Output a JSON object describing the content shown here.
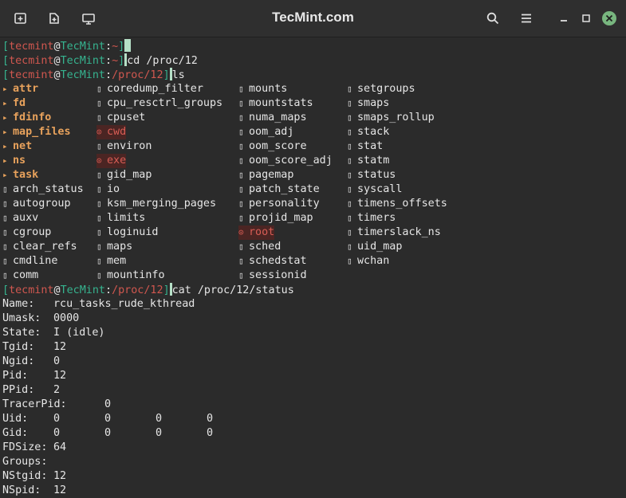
{
  "window": {
    "title": "TecMint.com",
    "buttons": [
      "new-tab",
      "new-window",
      "split"
    ]
  },
  "prompts": [
    {
      "user": "tecmint",
      "host": "TecMint",
      "path": "~",
      "cmd": ""
    },
    {
      "user": "tecmint",
      "host": "TecMint",
      "path": "~",
      "cmd": "cd /proc/12"
    },
    {
      "user": "tecmint",
      "host": "TecMint",
      "path": "/proc/12",
      "cmd": "ls"
    },
    {
      "user": "tecmint",
      "host": "TecMint",
      "path": "/proc/12",
      "cmd": "cat /proc/12/status"
    }
  ],
  "ls_rows": [
    [
      {
        "t": "attr",
        "k": "dir"
      },
      {
        "t": "coredump_filter",
        "k": "file"
      },
      {
        "t": "mounts",
        "k": "file"
      },
      {
        "t": "setgroups",
        "k": "file"
      }
    ],
    [
      {
        "t": "fd",
        "k": "dir"
      },
      {
        "t": "cpu_resctrl_groups",
        "k": "file"
      },
      {
        "t": "mountstats",
        "k": "file"
      },
      {
        "t": "smaps",
        "k": "file"
      }
    ],
    [
      {
        "t": "fdinfo",
        "k": "dir"
      },
      {
        "t": "cpuset",
        "k": "file"
      },
      {
        "t": "numa_maps",
        "k": "file"
      },
      {
        "t": "smaps_rollup",
        "k": "file"
      }
    ],
    [
      {
        "t": "map_files",
        "k": "dir"
      },
      {
        "t": "cwd",
        "k": "link"
      },
      {
        "t": "oom_adj",
        "k": "file"
      },
      {
        "t": "stack",
        "k": "file"
      }
    ],
    [
      {
        "t": "net",
        "k": "dir"
      },
      {
        "t": "environ",
        "k": "file"
      },
      {
        "t": "oom_score",
        "k": "file"
      },
      {
        "t": "stat",
        "k": "file"
      }
    ],
    [
      {
        "t": "ns",
        "k": "dir"
      },
      {
        "t": "exe",
        "k": "link"
      },
      {
        "t": "oom_score_adj",
        "k": "file"
      },
      {
        "t": "statm",
        "k": "file"
      }
    ],
    [
      {
        "t": "task",
        "k": "dir"
      },
      {
        "t": "gid_map",
        "k": "file"
      },
      {
        "t": "pagemap",
        "k": "file"
      },
      {
        "t": "status",
        "k": "file"
      }
    ],
    [
      {
        "t": "arch_status",
        "k": "file"
      },
      {
        "t": "io",
        "k": "file"
      },
      {
        "t": "patch_state",
        "k": "file"
      },
      {
        "t": "syscall",
        "k": "file"
      }
    ],
    [
      {
        "t": "autogroup",
        "k": "file"
      },
      {
        "t": "ksm_merging_pages",
        "k": "file"
      },
      {
        "t": "personality",
        "k": "file"
      },
      {
        "t": "timens_offsets",
        "k": "file"
      }
    ],
    [
      {
        "t": "auxv",
        "k": "file"
      },
      {
        "t": "limits",
        "k": "file"
      },
      {
        "t": "projid_map",
        "k": "file"
      },
      {
        "t": "timers",
        "k": "file"
      }
    ],
    [
      {
        "t": "cgroup",
        "k": "file"
      },
      {
        "t": "loginuid",
        "k": "file"
      },
      {
        "t": "root",
        "k": "link"
      },
      {
        "t": "timerslack_ns",
        "k": "file"
      }
    ],
    [
      {
        "t": "clear_refs",
        "k": "file"
      },
      {
        "t": "maps",
        "k": "file"
      },
      {
        "t": "sched",
        "k": "file"
      },
      {
        "t": "uid_map",
        "k": "file"
      }
    ],
    [
      {
        "t": "cmdline",
        "k": "file"
      },
      {
        "t": "mem",
        "k": "file"
      },
      {
        "t": "schedstat",
        "k": "file"
      },
      {
        "t": "wchan",
        "k": "file"
      }
    ],
    [
      {
        "t": "comm",
        "k": "file"
      },
      {
        "t": "mountinfo",
        "k": "file"
      },
      {
        "t": "sessionid",
        "k": "file"
      },
      null
    ]
  ],
  "status_lines": [
    {
      "key": "Name:",
      "vals": [
        "rcu_tasks_rude_kthread"
      ]
    },
    {
      "key": "Umask:",
      "vals": [
        "0000"
      ]
    },
    {
      "key": "State:",
      "vals": [
        "I (idle)"
      ]
    },
    {
      "key": "Tgid:",
      "vals": [
        "12"
      ]
    },
    {
      "key": "Ngid:",
      "vals": [
        "0"
      ]
    },
    {
      "key": "Pid:",
      "vals": [
        "12"
      ]
    },
    {
      "key": "PPid:",
      "vals": [
        "2"
      ]
    },
    {
      "key": "TracerPid:",
      "vals": [
        "0"
      ]
    },
    {
      "key": "Uid:",
      "vals": [
        "0",
        "0",
        "0",
        "0"
      ]
    },
    {
      "key": "Gid:",
      "vals": [
        "0",
        "0",
        "0",
        "0"
      ]
    },
    {
      "key": "FDSize:",
      "vals": [
        "64"
      ]
    },
    {
      "key": "Groups:",
      "vals": []
    },
    {
      "key": "NStgid:",
      "vals": [
        "12"
      ]
    },
    {
      "key": "NSpid:",
      "vals": [
        "12"
      ]
    }
  ]
}
